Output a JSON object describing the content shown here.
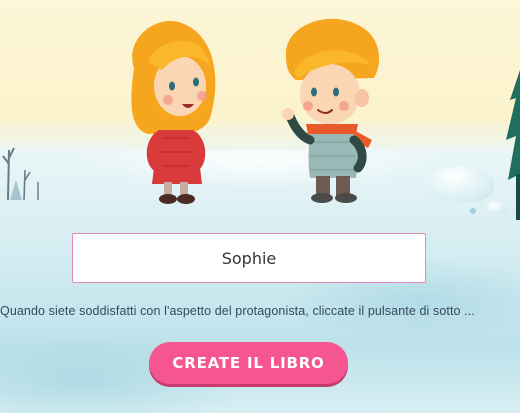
{
  "characters": {
    "girl": {
      "name": "girl-character"
    },
    "boy": {
      "name": "boy-character"
    }
  },
  "name_field": {
    "value": "Sophie",
    "accent_color": "#e08ab4"
  },
  "instructions": {
    "text": "Quando siete soddisfatti con l'aspetto del protagonista, cliccate il pulsante di sotto ..."
  },
  "create_button": {
    "label": "CREATE IL LIBRO",
    "color": "#f5568f"
  },
  "scene": {
    "sky_color": "#fdf6d7",
    "snow_color": "#d3ecf1"
  }
}
